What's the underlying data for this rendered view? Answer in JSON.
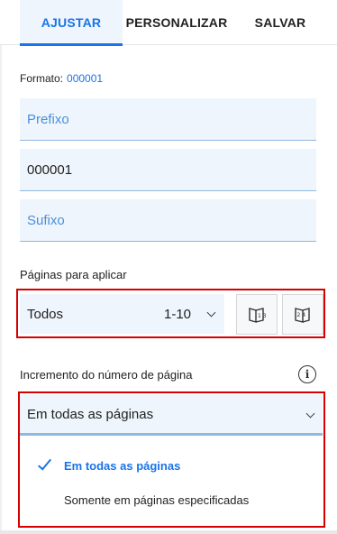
{
  "tabs": [
    {
      "label": "AJUSTAR",
      "active": true
    },
    {
      "label": "PERSONALIZAR",
      "active": false
    },
    {
      "label": "SALVAR",
      "active": false
    }
  ],
  "format": {
    "label": "Formato:",
    "value": "000001"
  },
  "fields": {
    "prefix": {
      "placeholder": "Prefixo",
      "value": ""
    },
    "number": {
      "placeholder": "",
      "value": "000001"
    },
    "suffix": {
      "placeholder": "Sufixo",
      "value": ""
    }
  },
  "pages": {
    "label": "Páginas para aplicar",
    "selected": "Todos",
    "range": "1-10",
    "buttons": [
      "odd-pages-icon",
      "even-pages-icon"
    ]
  },
  "increment": {
    "label": "Incremento do número de página",
    "selected": "Em todas as páginas",
    "options": [
      {
        "label": "Em todas as páginas",
        "selected": true
      },
      {
        "label": "Somente em páginas especificadas",
        "selected": false
      }
    ]
  },
  "colors": {
    "accent": "#1a73e8",
    "highlight": "#d60000",
    "field_bg": "#eef5fc"
  }
}
